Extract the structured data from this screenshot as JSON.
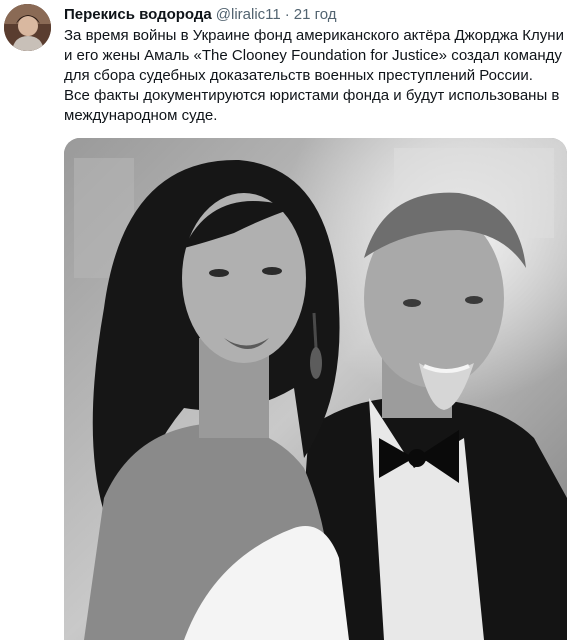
{
  "tweet": {
    "author_name": "Перекись водорода",
    "author_handle": "@liralic11",
    "separator": "·",
    "timestamp": "21 год",
    "text_lines": [
      "За время войны в Украине фонд американского актёра Джорджа Клуни",
      "и его жены Амаль «The Clooney Foundation for Justice» создал команду",
      "для сбора судебных доказательств военных преступлений России.",
      "Все факты документируются юристами фонда и будут использованы в",
      "международном суде."
    ],
    "avatar_icon": "profile-avatar",
    "media_icon": "photo"
  }
}
